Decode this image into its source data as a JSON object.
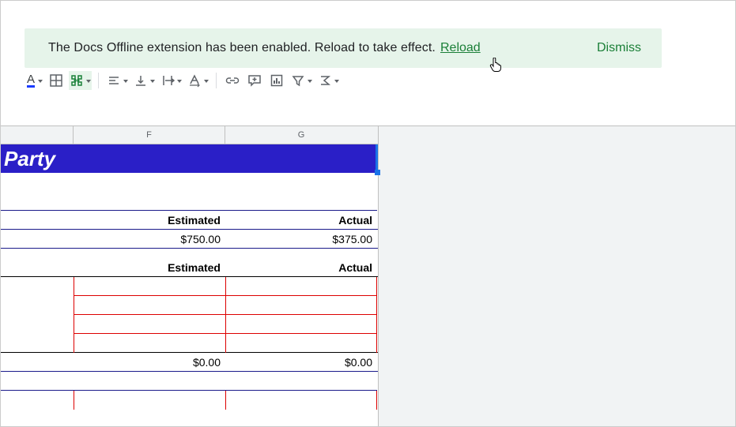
{
  "banner": {
    "message": "The Docs Offline extension has been enabled. Reload to take effect.",
    "reload_label": "Reload",
    "dismiss_label": "Dismiss"
  },
  "toolbar": {
    "text_color_glyph": "A"
  },
  "columns": {
    "f": "F",
    "g": "G"
  },
  "sheet": {
    "title": "Party",
    "headers": {
      "estimated": "Estimated",
      "actual": "Actual"
    },
    "row1": {
      "estimated": "$750.00",
      "actual": "$375.00"
    },
    "totals": {
      "estimated": "$0.00",
      "actual": "$0.00"
    }
  }
}
